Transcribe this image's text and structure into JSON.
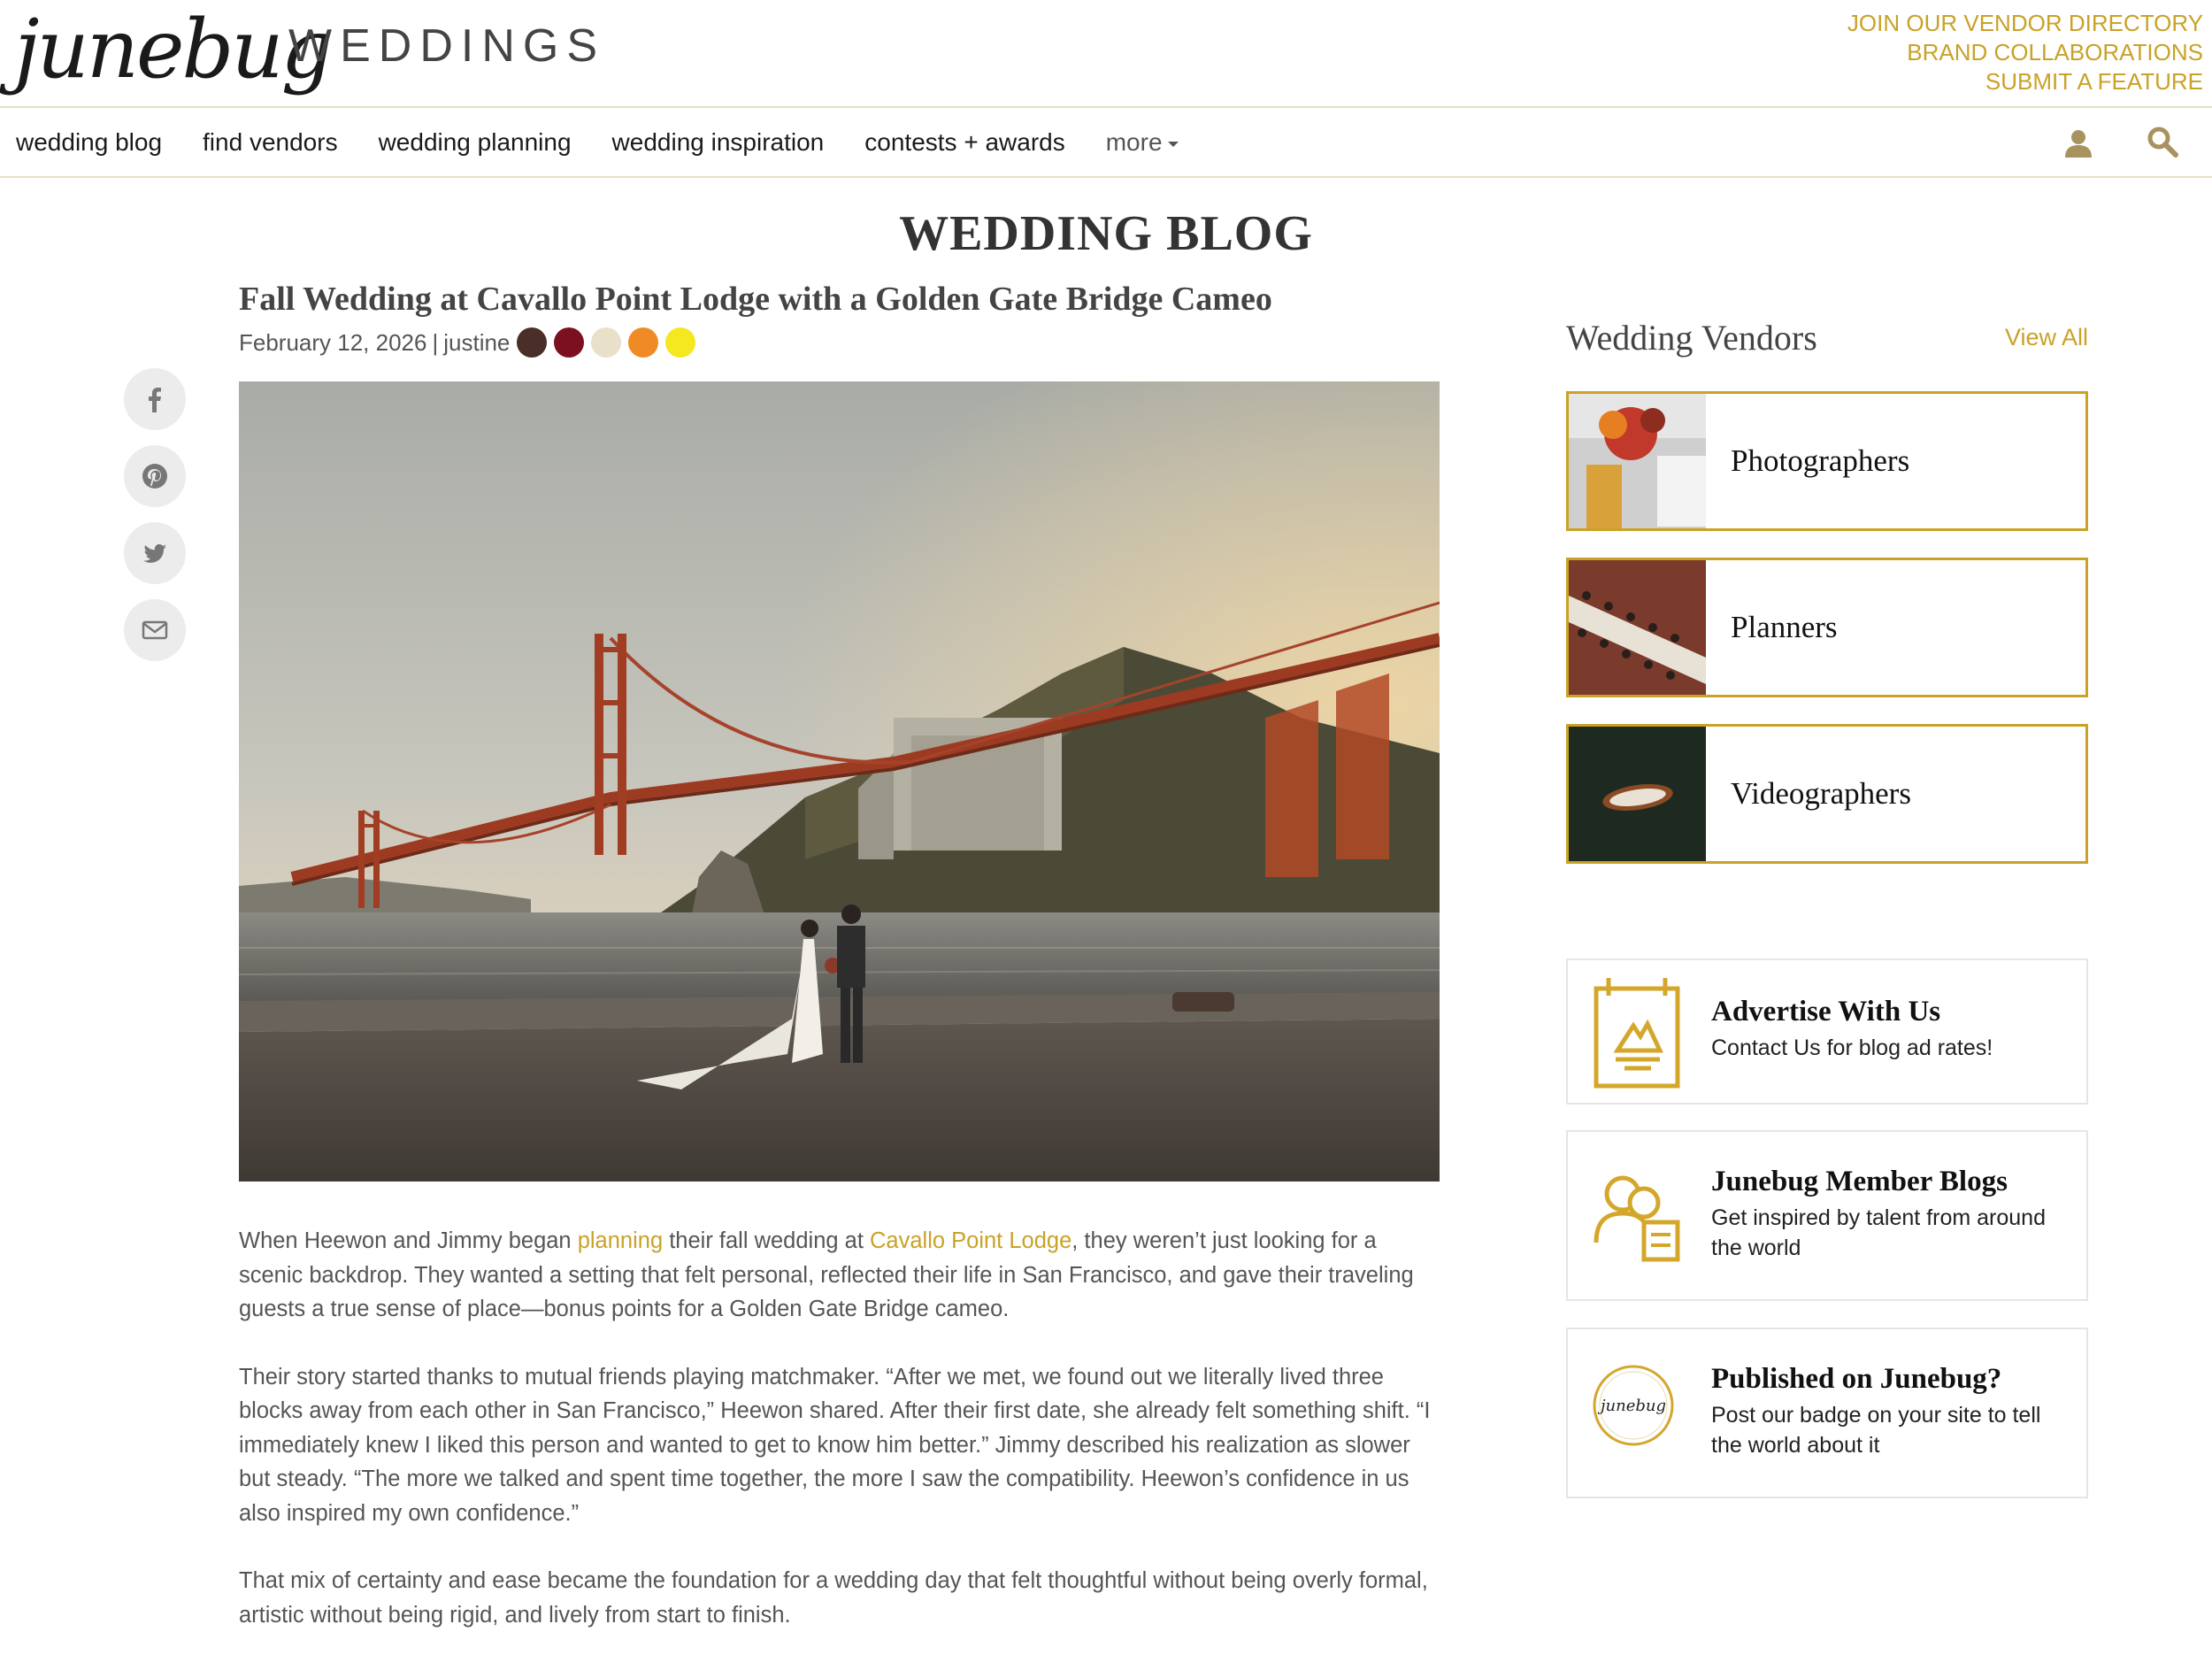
{
  "header": {
    "logo_script": "junebug",
    "logo_word": "WEDDINGS",
    "top_links": [
      "JOIN OUR VENDOR DIRECTORY",
      "BRAND COLLABORATIONS",
      "SUBMIT A FEATURE"
    ]
  },
  "nav": {
    "items": [
      "wedding blog",
      "find vendors",
      "wedding planning",
      "wedding inspiration",
      "contests + awards"
    ],
    "more": "more",
    "icons": [
      "user-icon",
      "search-icon"
    ]
  },
  "section_title": "WEDDING BLOG",
  "post": {
    "title": "Fall Wedding at Cavallo Point Lodge with a Golden Gate Bridge Cameo",
    "date": "February 12, 2026",
    "separator": "|",
    "author": "justine",
    "palette": [
      "#4a2e28",
      "#7a1020",
      "#e8e0c8",
      "#f08a24",
      "#f5e820"
    ]
  },
  "share": [
    "facebook-icon",
    "pinterest-icon",
    "twitter-icon",
    "email-icon"
  ],
  "article": {
    "p1_before": "When Heewon and Jimmy began ",
    "p1_link1": "planning",
    "p1_mid": " their fall wedding at ",
    "p1_link2": "Cavallo Point Lodge",
    "p1_after": ", they weren’t just looking for a scenic backdrop. They wanted a setting that felt personal, reflected their life in San Francisco, and gave their traveling guests a true sense of place—bonus points for a Golden Gate Bridge cameo.",
    "p2": "Their story started thanks to mutual friends playing matchmaker. “After we met, we found out we literally lived three blocks away from each other in San Francisco,” Heewon shared. After their first date, she already felt something shift. “I immediately knew I liked this person and wanted to get to know him better.” Jimmy described his realization as slower but steady. “The more we talked and spent time together, the more I saw the compatibility. Heewon’s confidence in us also inspired my own confidence.”",
    "p3": "That mix of certainty and ease became the foundation for a wedding day that felt thoughtful without being overly formal, artistic without being rigid, and lively from start to finish."
  },
  "sidebar": {
    "heading": "Wedding Vendors",
    "view_all": "View All",
    "vendors": [
      "Photographers",
      "Planners",
      "Videographers"
    ],
    "promos": [
      {
        "title": "Advertise With Us",
        "text": "Contact Us for blog ad rates!"
      },
      {
        "title": "Junebug Member Blogs",
        "text": "Get inspired by talent from around the world"
      },
      {
        "title": "Published on Junebug?",
        "text": "Post our badge on your site to tell the world about it"
      }
    ],
    "badge_text": "junebug"
  },
  "colors": {
    "accent": "#c9a227",
    "text": "#555555"
  }
}
